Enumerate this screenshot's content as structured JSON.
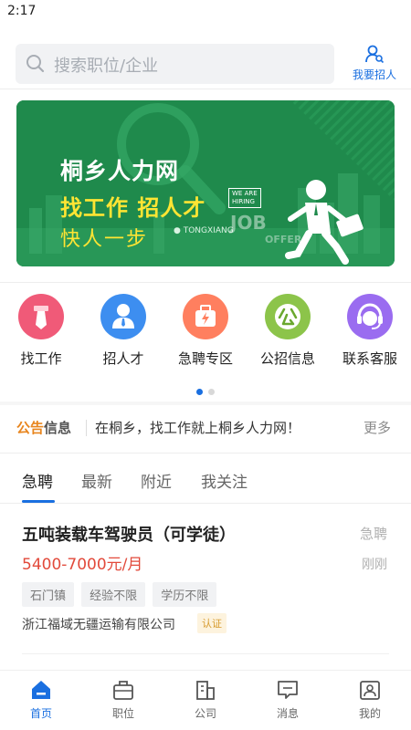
{
  "status_bar": {
    "time": "2:17"
  },
  "header": {
    "search_placeholder": "搜索职位/企业",
    "hire_label": "我要招人"
  },
  "banner": {
    "title": "桐乡人力网",
    "slogan": "找工作 招人才",
    "tagline": "快人一步",
    "location": "TONGXIANG",
    "sign": "WE ARE HIRING",
    "job_text": "JOB",
    "offer_text": "OFFER"
  },
  "quick_menu": [
    {
      "label": "找工作",
      "color": "#f05a78",
      "icon": "tie-icon"
    },
    {
      "label": "招人才",
      "color": "#3d8ef0",
      "icon": "person-icon"
    },
    {
      "label": "急聘专区",
      "color": "#ff7f5f",
      "icon": "urgent-bag-icon"
    },
    {
      "label": "公招信息",
      "color": "#8cc44a",
      "icon": "public-icon"
    },
    {
      "label": "联系客服",
      "color": "#9a6cf0",
      "icon": "service-icon"
    }
  ],
  "pager": {
    "pages": 2,
    "current": 1
  },
  "notice": {
    "tag_part1": "公告",
    "tag_part2": "信息",
    "message": "在桐乡，找工作就上桐乡人力网！",
    "more": "更多"
  },
  "tabs": [
    "急聘",
    "最新",
    "附近",
    "我关注"
  ],
  "active_tab": "急聘",
  "jobs": [
    {
      "title": "五吨装载车驾驶员（可学徒）",
      "badge": "急聘",
      "salary": "5400-7000元/月",
      "time": "刚刚",
      "tags": [
        "石门镇",
        "经验不限",
        "学历不限"
      ],
      "company": "浙江福域无疆运输有限公司",
      "cert": "认证"
    }
  ],
  "tabbar": [
    {
      "label": "首页",
      "icon": "home-icon",
      "active": true
    },
    {
      "label": "职位",
      "icon": "briefcase-icon",
      "active": false
    },
    {
      "label": "公司",
      "icon": "building-icon",
      "active": false
    },
    {
      "label": "消息",
      "icon": "message-icon",
      "active": false
    },
    {
      "label": "我的",
      "icon": "profile-icon",
      "active": false
    }
  ],
  "colors": {
    "primary": "#1a6fe0",
    "salary": "#e24a3b",
    "banner_green": "#1f8a4c",
    "banner_yellow": "#ffe533"
  }
}
